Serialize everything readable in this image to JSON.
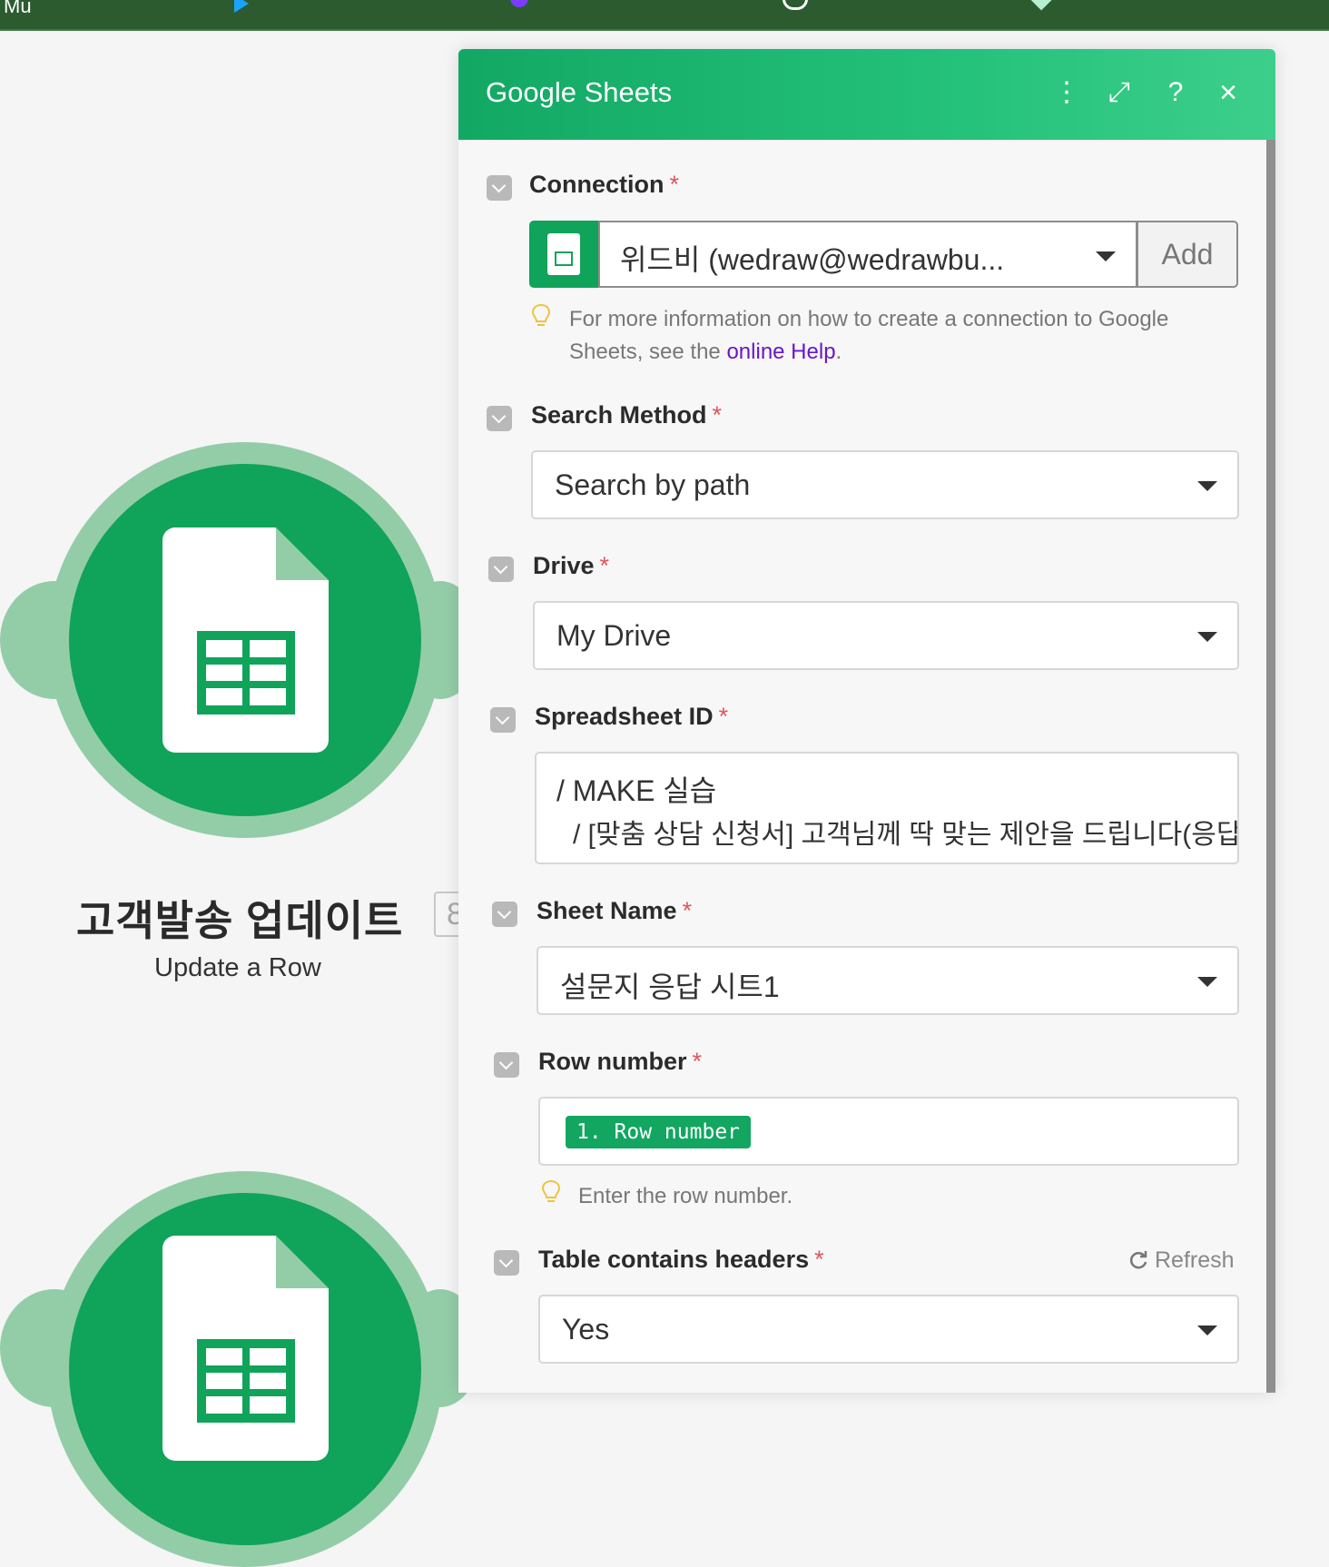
{
  "topbar": {
    "fragments": [
      "Mu"
    ]
  },
  "module": {
    "title": "고객발송 업데이트",
    "subtitle": "Update a Row",
    "id_badge": "8",
    "icon": "google-sheets-icon"
  },
  "panel": {
    "title": "Google Sheets",
    "icons": [
      "more-vertical-icon",
      "expand-icon",
      "help-icon",
      "close-icon"
    ],
    "help_glyph": "?",
    "close_glyph": "×",
    "more_glyph": "⋮",
    "expand_glyph": "⤢",
    "fields": {
      "connection": {
        "label": "Connection",
        "required": "*",
        "value": "위드비 (wedraw@wedrawbu...",
        "add_label": "Add",
        "hint_text": "For more information on how to create a connection to Google Sheets, see the ",
        "hint_link": "online Help",
        "hint_end": "."
      },
      "search_method": {
        "label": "Search Method",
        "required": "*",
        "value": "Search by path"
      },
      "drive": {
        "label": "Drive",
        "required": "*",
        "value": "My Drive"
      },
      "spreadsheet_id": {
        "label": "Spreadsheet ID",
        "required": "*",
        "path_line1": "/  MAKE 실습",
        "path_line2": "/  [맞춤 상담 신청서] 고객님께 딱 맞는 제안을 드립니다(응답"
      },
      "sheet_name": {
        "label": "Sheet Name",
        "required": "*",
        "value": "설문지 응답 시트1"
      },
      "row_number": {
        "label": "Row number",
        "required": "*",
        "pill": "1. Row number",
        "hint": "Enter the row number."
      },
      "table_headers": {
        "label": "Table contains headers",
        "required": "*",
        "refresh_label": "Refresh",
        "value": "Yes"
      }
    }
  },
  "colors": {
    "brand_green": "#10a35a",
    "header_green": "#24c17a",
    "halo_green": "#93cda7",
    "required_red": "#e0555b",
    "link_purple": "#6a16c8"
  }
}
